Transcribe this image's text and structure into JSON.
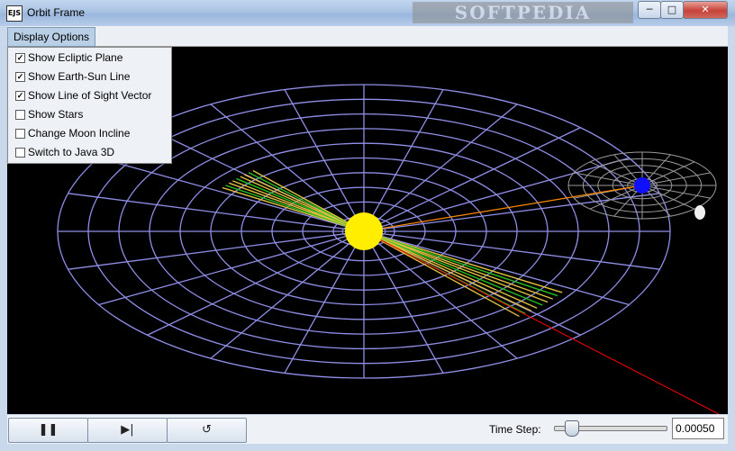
{
  "window": {
    "title": "Orbit Frame",
    "app_icon_text": "EJS",
    "watermark": "SOFTPEDIA",
    "minimize_glyph": "─",
    "maximize_glyph": "□",
    "close_glyph": "✕"
  },
  "menu": {
    "display_options": "Display Options",
    "items": [
      {
        "label": "Show Ecliptic Plane",
        "checked": true,
        "mark": "✓"
      },
      {
        "label": "Show Earth-Sun Line",
        "checked": true,
        "mark": "✓"
      },
      {
        "label": "Show Line of Sight Vector",
        "checked": true,
        "mark": "✓"
      },
      {
        "label": "Show Stars",
        "checked": false,
        "mark": ""
      },
      {
        "label": "Change Moon Incline",
        "checked": false,
        "mark": ""
      },
      {
        "label": "Switch to Java 3D",
        "checked": false,
        "mark": ""
      }
    ]
  },
  "toolbar": {
    "pause_glyph": "❚❚",
    "step_glyph": "▶|",
    "reset_glyph": "↺",
    "time_step_label": "Time Step:",
    "time_step_value": "0.00050",
    "time_step_slider_fraction": 0.15
  },
  "colors": {
    "grid": "#8f8fe8",
    "sun": "#ffee00",
    "earth": "#1010ff",
    "sight_vector": "#ff0000",
    "earth_sun_line": "#ff8800",
    "lit_band": "#e0c040",
    "green_band": "#20c020",
    "moon_grid": "#9a9a9a"
  }
}
